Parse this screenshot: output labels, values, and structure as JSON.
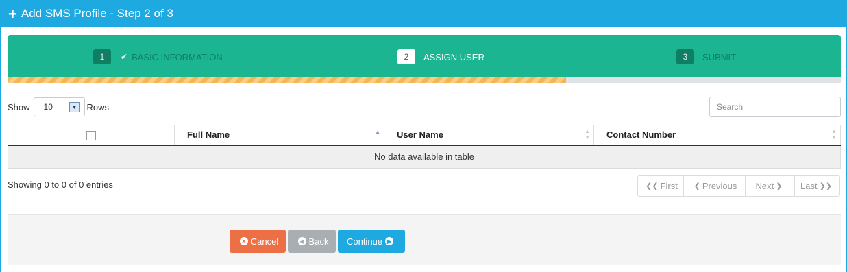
{
  "header": {
    "icon": "plus-icon",
    "title": "Add SMS Profile - Step 2 of 3",
    "color": "#1fa9e1"
  },
  "wizard": {
    "color": "#1bb592",
    "steps": [
      {
        "number": "1",
        "label": "BASIC INFORMATION",
        "state": "done",
        "icon": "check-icon"
      },
      {
        "number": "2",
        "label": "ASSIGN USER",
        "state": "active"
      },
      {
        "number": "3",
        "label": "SUBMIT",
        "state": "pending"
      }
    ],
    "progress_percent": 67
  },
  "table_controls": {
    "show_label": "Show",
    "rows_value": "10",
    "rows_label": "Rows",
    "search_placeholder": "Search"
  },
  "table": {
    "columns": [
      "",
      "Full Name",
      "User Name",
      "Contact Number"
    ],
    "sorted_column": "Full Name",
    "sort_direction": "ascending",
    "empty_message": "No data available in table"
  },
  "info_text": "Showing 0 to 0 of 0 entries",
  "pagination": {
    "first": "First",
    "previous": "Previous",
    "next": "Next",
    "last": "Last"
  },
  "buttons": {
    "cancel": {
      "label": "Cancel",
      "color": "#ec6f46"
    },
    "back": {
      "label": "Back",
      "color": "#a9aeb3"
    },
    "continue": {
      "label": "Continue",
      "color": "#1fa9e1"
    }
  }
}
